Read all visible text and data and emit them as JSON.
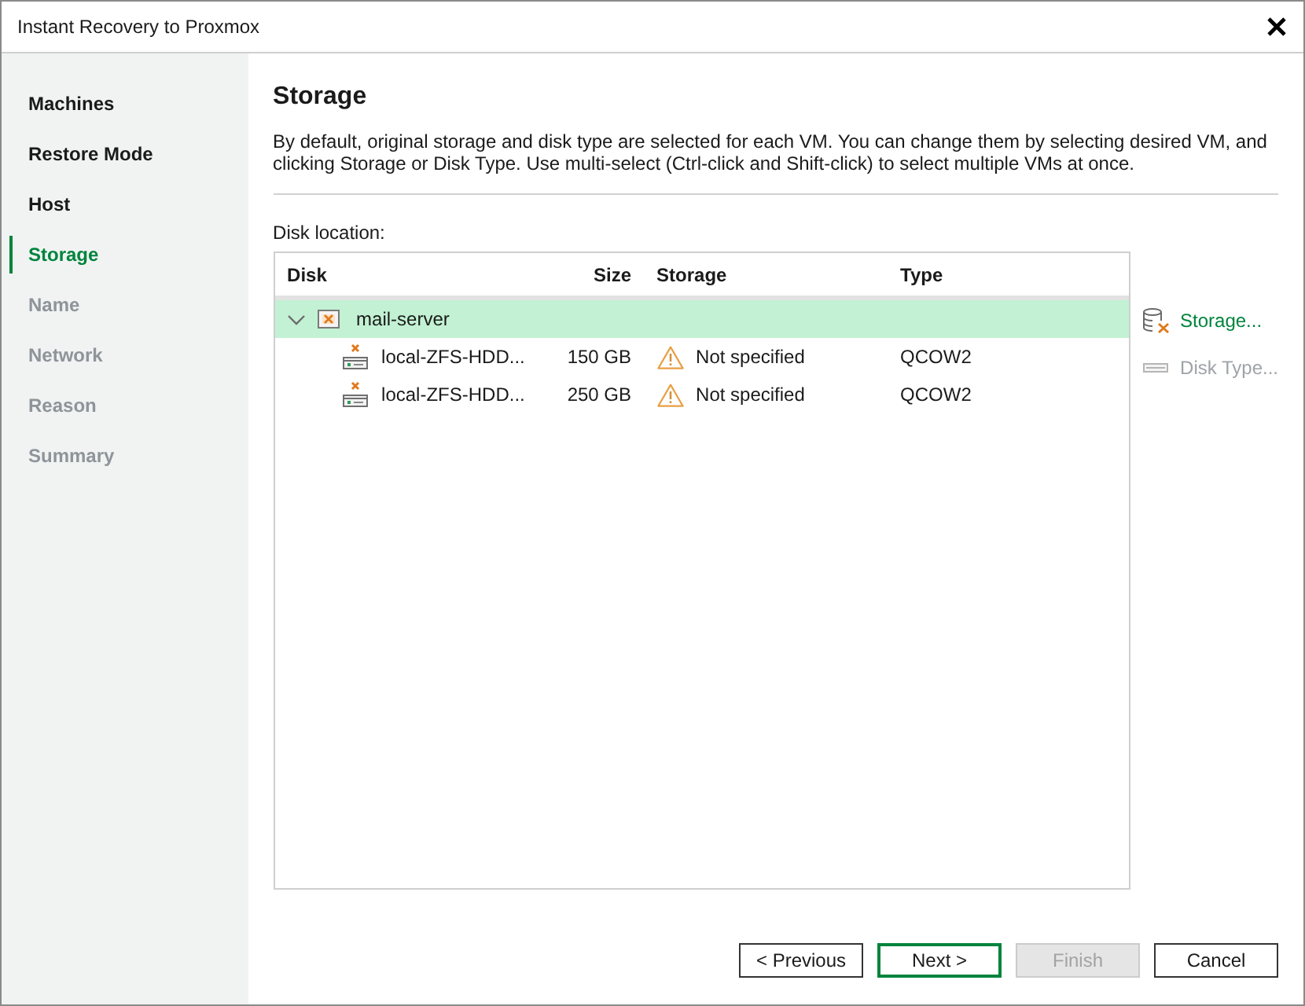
{
  "window": {
    "title": "Instant Recovery to Proxmox"
  },
  "steps": [
    {
      "label": "Machines",
      "selected": false,
      "disabled": false
    },
    {
      "label": "Restore Mode",
      "selected": false,
      "disabled": false
    },
    {
      "label": "Host",
      "selected": false,
      "disabled": false
    },
    {
      "label": "Storage",
      "selected": true,
      "disabled": false
    },
    {
      "label": "Name",
      "selected": false,
      "disabled": true
    },
    {
      "label": "Network",
      "selected": false,
      "disabled": true
    },
    {
      "label": "Reason",
      "selected": false,
      "disabled": true
    },
    {
      "label": "Summary",
      "selected": false,
      "disabled": true
    }
  ],
  "page": {
    "title": "Storage",
    "description": "By default, original storage and disk type are selected for each VM. You can change them by selecting desired VM, and clicking Storage or Disk Type. Use multi-select (Ctrl-click and Shift-click) to select multiple VMs at once."
  },
  "disk_location": {
    "label": "Disk location:",
    "columns": [
      "Disk",
      "Size",
      "Storage",
      "Type"
    ],
    "rows": [
      {
        "kind": "vm",
        "name": "mail-server",
        "expanded": true,
        "selected": true,
        "children": [
          {
            "kind": "disk",
            "name": "local-ZFS-HDD...",
            "size": "150 GB",
            "storage": "Not specified",
            "warning": true,
            "type": "QCOW2",
            "selected": false
          },
          {
            "kind": "disk",
            "name": "local-ZFS-HDD...",
            "size": "250 GB",
            "storage": "Not specified",
            "warning": true,
            "type": "QCOW2",
            "selected": false
          }
        ]
      }
    ]
  },
  "actions": [
    {
      "kind": "storage",
      "label": "Storage...",
      "disabled": false
    },
    {
      "kind": "disktype",
      "label": "Disk Type...",
      "disabled": true
    }
  ],
  "buttons": [
    {
      "label": "< Previous",
      "default": false,
      "disabled": false
    },
    {
      "label": "Next >",
      "default": true,
      "disabled": false
    },
    {
      "label": "Finish",
      "default": false,
      "disabled": true
    },
    {
      "label": "Cancel",
      "default": false,
      "disabled": false
    }
  ]
}
